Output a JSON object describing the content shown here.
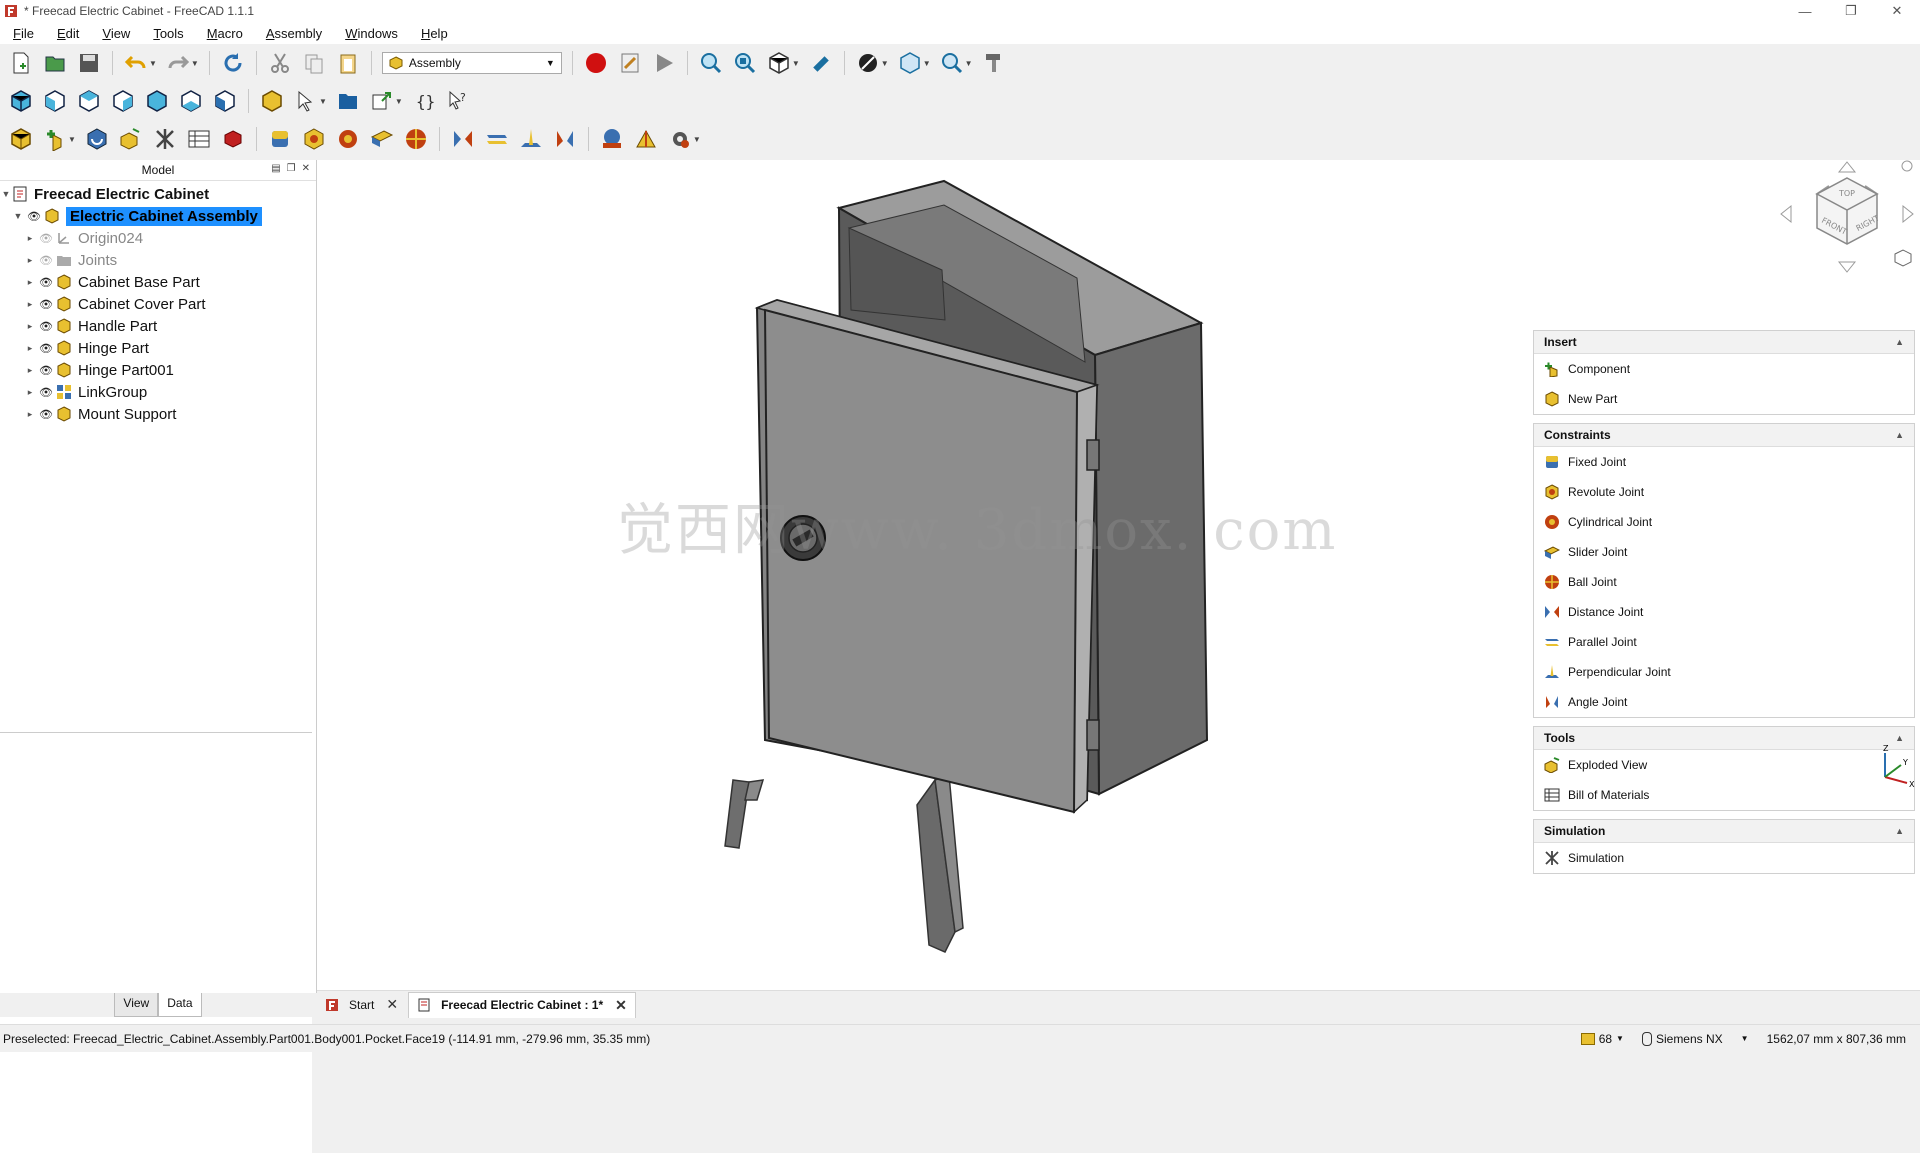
{
  "window": {
    "title": "* Freecad Electric Cabinet - FreeCAD 1.1.1"
  },
  "menu": [
    "File",
    "Edit",
    "View",
    "Tools",
    "Macro",
    "Assembly",
    "Windows",
    "Help"
  ],
  "toolbar": {
    "workbench": "Assembly"
  },
  "model_panel": {
    "title": "Model",
    "root": "Freecad Electric Cabinet",
    "assembly": "Electric Cabinet Assembly",
    "children": [
      {
        "label": "Origin024",
        "icon": "origin-icon",
        "hidden": true
      },
      {
        "label": "Joints",
        "icon": "folder-icon",
        "hidden": true
      },
      {
        "label": "Cabinet Base Part",
        "icon": "part-icon",
        "hidden": false
      },
      {
        "label": "Cabinet Cover Part",
        "icon": "part-icon",
        "hidden": false
      },
      {
        "label": "Handle Part",
        "icon": "part-icon",
        "hidden": false
      },
      {
        "label": "Hinge Part",
        "icon": "part-icon",
        "hidden": false
      },
      {
        "label": "Hinge Part001",
        "icon": "part-icon",
        "hidden": false
      },
      {
        "label": "LinkGroup",
        "icon": "linkgroup-icon",
        "hidden": false
      },
      {
        "label": "Mount Support",
        "icon": "part-icon",
        "hidden": false
      }
    ],
    "tabs": [
      "View",
      "Data"
    ]
  },
  "viewport": {
    "watermark": "觉西网www. 3dmox. com",
    "navcube": {
      "top": "TOP",
      "front": "FRONT",
      "right": "RIGHT"
    },
    "axes": {
      "x": "X",
      "y": "Y",
      "z": "Z"
    }
  },
  "task_panel": {
    "insert": {
      "title": "Insert",
      "items": [
        "Component",
        "New Part"
      ]
    },
    "constraints": {
      "title": "Constraints",
      "items": [
        "Fixed Joint",
        "Revolute Joint",
        "Cylindrical Joint",
        "Slider Joint",
        "Ball Joint",
        "Distance Joint",
        "Parallel Joint",
        "Perpendicular Joint",
        "Angle Joint"
      ]
    },
    "tools": {
      "title": "Tools",
      "items": [
        "Exploded View",
        "Bill of Materials"
      ]
    },
    "simulation": {
      "title": "Simulation",
      "items": [
        "Simulation"
      ]
    }
  },
  "doc_tabs": [
    {
      "label": "Start",
      "active": false
    },
    {
      "label": "Freecad Electric Cabinet : 1*",
      "active": true
    }
  ],
  "status": {
    "message": "Preselected: Freecad_Electric_Cabinet.Assembly.Part001.Body001.Pocket.Face19 (-114.91 mm, -279.96 mm, 35.35 mm)",
    "count": "68",
    "nav_style": "Siemens NX",
    "dimensions": "1562,07 mm x 807,36 mm"
  }
}
